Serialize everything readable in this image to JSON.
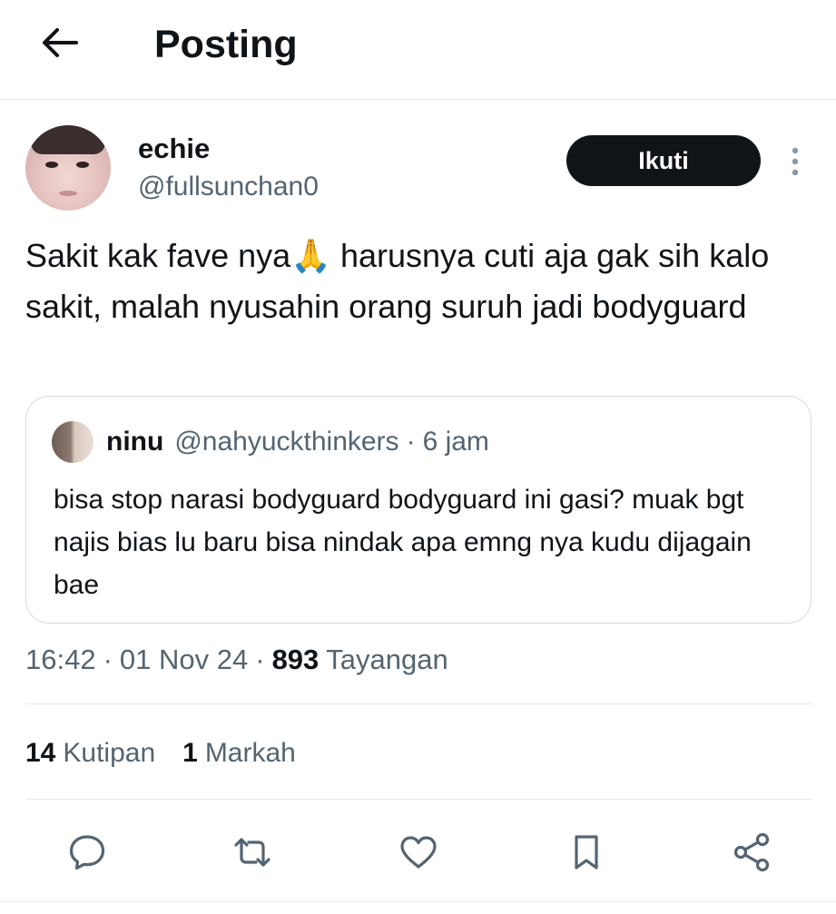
{
  "header": {
    "back_icon": "arrow-left-icon",
    "title": "Posting"
  },
  "author": {
    "display_name": "echie",
    "handle": "@fullsunchan0",
    "follow_label": "Ikuti",
    "more_icon": "more-vertical-icon"
  },
  "tweet": {
    "text": "Sakit kak fave nya🙏 harusnya cuti aja gak sih kalo sakit, malah nyusahin orang suruh jadi bodyguard"
  },
  "quote": {
    "name": "ninu",
    "handle": "@nahyuckthinkers",
    "separator": "·",
    "time": "6 jam",
    "text": "bisa stop narasi bodyguard bodyguard ini gasi? muak bgt najis bias lu baru bisa nindak apa emng nya kudu dijagain bae"
  },
  "meta": {
    "time": "16:42",
    "separator": "·",
    "date": "01 Nov 24",
    "views_count": "893",
    "views_label": "Tayangan"
  },
  "stats": [
    {
      "count": "14",
      "label": "Kutipan"
    },
    {
      "count": "1",
      "label": "Markah"
    }
  ],
  "actions": [
    "reply-icon",
    "retweet-icon",
    "like-icon",
    "bookmark-icon",
    "share-icon"
  ],
  "colors": {
    "text_primary": "#0f1419",
    "text_secondary": "#536471",
    "border": "#e6e8ea",
    "follow_button_bg": "#0f1419",
    "follow_button_text": "#ffffff"
  }
}
